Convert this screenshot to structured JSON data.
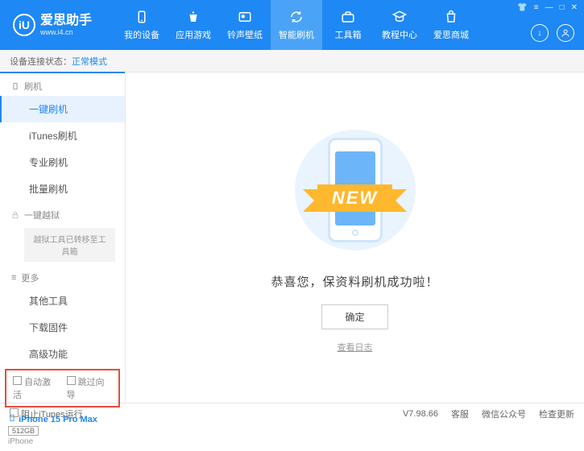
{
  "app": {
    "name": "爱思助手",
    "site": "www.i4.cn"
  },
  "nav": [
    {
      "label": "我的设备"
    },
    {
      "label": "应用游戏"
    },
    {
      "label": "铃声壁纸"
    },
    {
      "label": "智能刷机"
    },
    {
      "label": "工具箱"
    },
    {
      "label": "教程中心"
    },
    {
      "label": "爱思商城"
    }
  ],
  "status": {
    "prefix": "设备连接状态：",
    "mode": "正常模式"
  },
  "sidebar": {
    "group_flash": "刷机",
    "items_flash": [
      "一键刷机",
      "iTunes刷机",
      "专业刷机",
      "批量刷机"
    ],
    "group_jailbreak": "一键越狱",
    "jailbreak_note": "越狱工具已转移至工具箱",
    "group_more": "更多",
    "items_more": [
      "其他工具",
      "下载固件",
      "高级功能"
    ],
    "auto_activate": "自动激活",
    "skip_guide": "跳过向导"
  },
  "device": {
    "name": "iPhone 15 Pro Max",
    "storage": "512GB",
    "type": "iPhone"
  },
  "main": {
    "ribbon": "NEW",
    "success": "恭喜您，保资料刷机成功啦！",
    "ok": "确定",
    "log": "查看日志"
  },
  "footer": {
    "block_itunes": "阻止iTunes运行",
    "version": "V7.98.66",
    "links": [
      "客服",
      "微信公众号",
      "检查更新"
    ]
  }
}
